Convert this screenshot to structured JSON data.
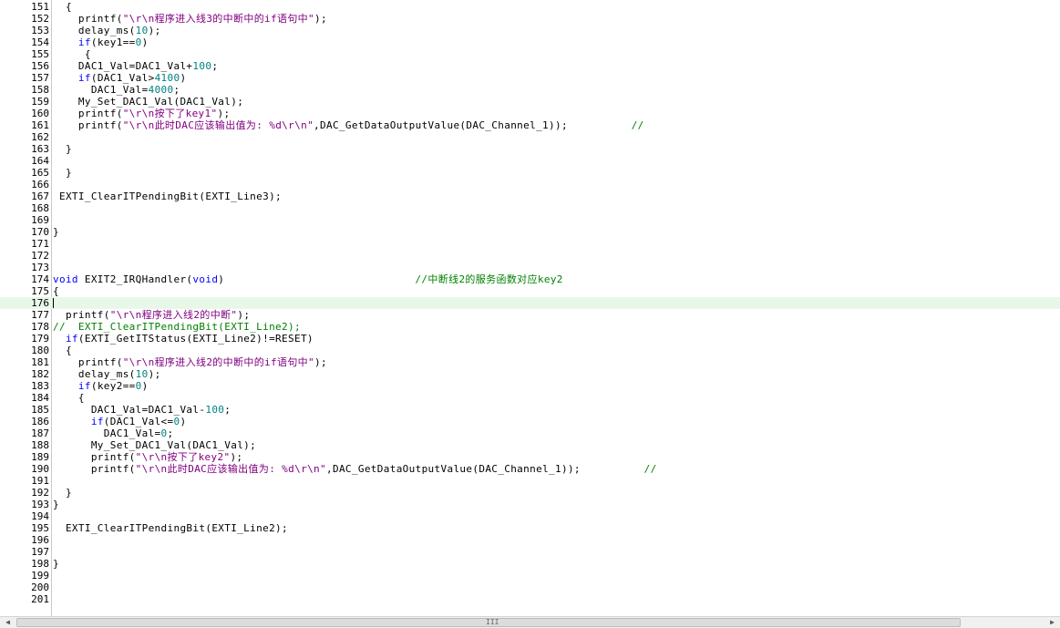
{
  "editor": {
    "current_line": 176,
    "lines": [
      {
        "n": "151",
        "code": [
          [
            "  {",
            ""
          ]
        ]
      },
      {
        "n": "152",
        "code": [
          [
            "    printf(",
            ""
          ],
          [
            "\"\\r\\n程序进入线3的中断中的if语句中\"",
            "str"
          ],
          [
            ");",
            ""
          ]
        ]
      },
      {
        "n": "153",
        "code": [
          [
            "    delay_ms(",
            ""
          ],
          [
            "10",
            "num"
          ],
          [
            ");",
            ""
          ]
        ]
      },
      {
        "n": "154",
        "code": [
          [
            "    ",
            ""
          ],
          [
            "if",
            "kw"
          ],
          [
            "(key1==",
            ""
          ],
          [
            "0",
            "num"
          ],
          [
            ")",
            ""
          ]
        ]
      },
      {
        "n": "155",
        "code": [
          [
            "     {",
            ""
          ]
        ]
      },
      {
        "n": "156",
        "code": [
          [
            "    DAC1_Val=DAC1_Val+",
            ""
          ],
          [
            "100",
            "num"
          ],
          [
            ";",
            ""
          ]
        ]
      },
      {
        "n": "157",
        "code": [
          [
            "    ",
            ""
          ],
          [
            "if",
            "kw"
          ],
          [
            "(DAC1_Val>",
            ""
          ],
          [
            "4100",
            "num"
          ],
          [
            ")",
            ""
          ]
        ]
      },
      {
        "n": "158",
        "code": [
          [
            "      DAC1_Val=",
            ""
          ],
          [
            "4000",
            "num"
          ],
          [
            ";",
            ""
          ]
        ]
      },
      {
        "n": "159",
        "code": [
          [
            "    My_Set_DAC1_Val(DAC1_Val);",
            ""
          ]
        ]
      },
      {
        "n": "160",
        "code": [
          [
            "    printf(",
            ""
          ],
          [
            "\"\\r\\n按下了key1\"",
            "str"
          ],
          [
            ");",
            ""
          ]
        ]
      },
      {
        "n": "161",
        "code": [
          [
            "    printf(",
            ""
          ],
          [
            "\"\\r\\n此时DAC应该输出值为: %d\\r\\n\"",
            "str"
          ],
          [
            ",DAC_GetDataOutputValue(DAC_Channel_1));          ",
            ""
          ],
          [
            "//",
            "cmt"
          ]
        ]
      },
      {
        "n": "162",
        "code": []
      },
      {
        "n": "163",
        "code": [
          [
            "  }",
            ""
          ]
        ]
      },
      {
        "n": "164",
        "code": []
      },
      {
        "n": "165",
        "code": [
          [
            "  }",
            ""
          ]
        ]
      },
      {
        "n": "166",
        "code": []
      },
      {
        "n": "167",
        "code": [
          [
            " EXTI_ClearITPendingBit(EXTI_Line3);",
            ""
          ]
        ]
      },
      {
        "n": "168",
        "code": []
      },
      {
        "n": "169",
        "code": []
      },
      {
        "n": "170",
        "code": [
          [
            "}",
            ""
          ]
        ]
      },
      {
        "n": "171",
        "code": []
      },
      {
        "n": "172",
        "code": []
      },
      {
        "n": "173",
        "code": []
      },
      {
        "n": "174",
        "code": [
          [
            "void",
            "kw"
          ],
          [
            " EXIT2_IRQHandler(",
            ""
          ],
          [
            "void",
            "kw"
          ],
          [
            ")                              ",
            ""
          ],
          [
            "//中断线2的服务函数对应key2",
            "cmt"
          ]
        ]
      },
      {
        "n": "175",
        "code": [
          [
            "{",
            ""
          ]
        ]
      },
      {
        "n": "176",
        "code": []
      },
      {
        "n": "177",
        "code": [
          [
            "  printf(",
            ""
          ],
          [
            "\"\\r\\n程序进入线2的中断\"",
            "str"
          ],
          [
            ");",
            ""
          ]
        ]
      },
      {
        "n": "178",
        "code": [
          [
            "//  EXTI_ClearITPendingBit(EXTI_Line2);",
            "cmt"
          ]
        ]
      },
      {
        "n": "179",
        "code": [
          [
            "  ",
            ""
          ],
          [
            "if",
            "kw"
          ],
          [
            "(EXTI_GetITStatus(EXTI_Line2)!=RESET)",
            ""
          ]
        ]
      },
      {
        "n": "180",
        "code": [
          [
            "  {",
            ""
          ]
        ]
      },
      {
        "n": "181",
        "code": [
          [
            "    printf(",
            ""
          ],
          [
            "\"\\r\\n程序进入线2的中断中的if语句中\"",
            "str"
          ],
          [
            ");",
            ""
          ]
        ]
      },
      {
        "n": "182",
        "code": [
          [
            "    delay_ms(",
            ""
          ],
          [
            "10",
            "num"
          ],
          [
            ");",
            ""
          ]
        ]
      },
      {
        "n": "183",
        "code": [
          [
            "    ",
            ""
          ],
          [
            "if",
            "kw"
          ],
          [
            "(key2==",
            ""
          ],
          [
            "0",
            "num"
          ],
          [
            ")",
            ""
          ]
        ]
      },
      {
        "n": "184",
        "code": [
          [
            "    {",
            ""
          ]
        ]
      },
      {
        "n": "185",
        "code": [
          [
            "      DAC1_Val=DAC1_Val-",
            ""
          ],
          [
            "100",
            "num"
          ],
          [
            ";",
            ""
          ]
        ]
      },
      {
        "n": "186",
        "code": [
          [
            "      ",
            ""
          ],
          [
            "if",
            "kw"
          ],
          [
            "(DAC1_Val<=",
            ""
          ],
          [
            "0",
            "num"
          ],
          [
            ")",
            ""
          ]
        ]
      },
      {
        "n": "187",
        "code": [
          [
            "        DAC1_Val=",
            ""
          ],
          [
            "0",
            "num"
          ],
          [
            ";",
            ""
          ]
        ]
      },
      {
        "n": "188",
        "code": [
          [
            "      My_Set_DAC1_Val(DAC1_Val);",
            ""
          ]
        ]
      },
      {
        "n": "189",
        "code": [
          [
            "      printf(",
            ""
          ],
          [
            "\"\\r\\n按下了key2\"",
            "str"
          ],
          [
            ");",
            ""
          ]
        ]
      },
      {
        "n": "190",
        "code": [
          [
            "      printf(",
            ""
          ],
          [
            "\"\\r\\n此时DAC应该输出值为: %d\\r\\n\"",
            "str"
          ],
          [
            ",DAC_GetDataOutputValue(DAC_Channel_1));          ",
            ""
          ],
          [
            "//",
            "cmt"
          ]
        ]
      },
      {
        "n": "191",
        "code": []
      },
      {
        "n": "192",
        "code": [
          [
            "  }",
            ""
          ]
        ]
      },
      {
        "n": "193",
        "code": [
          [
            "}",
            ""
          ]
        ]
      },
      {
        "n": "194",
        "code": []
      },
      {
        "n": "195",
        "code": [
          [
            "  EXTI_ClearITPendingBit(EXTI_Line2);",
            ""
          ]
        ]
      },
      {
        "n": "196",
        "code": []
      },
      {
        "n": "197",
        "code": []
      },
      {
        "n": "198",
        "code": [
          [
            "}",
            ""
          ]
        ]
      },
      {
        "n": "199",
        "code": []
      },
      {
        "n": "200",
        "code": []
      },
      {
        "n": "201",
        "code": []
      }
    ]
  },
  "scrollbar": {
    "left_arrow": "◀",
    "right_arrow": "▶",
    "grip": "III"
  },
  "colors": {
    "keyword": "#0000ff",
    "string": "#800080",
    "number": "#008080",
    "comment": "#008000",
    "current_line": "#e8f8e8"
  }
}
